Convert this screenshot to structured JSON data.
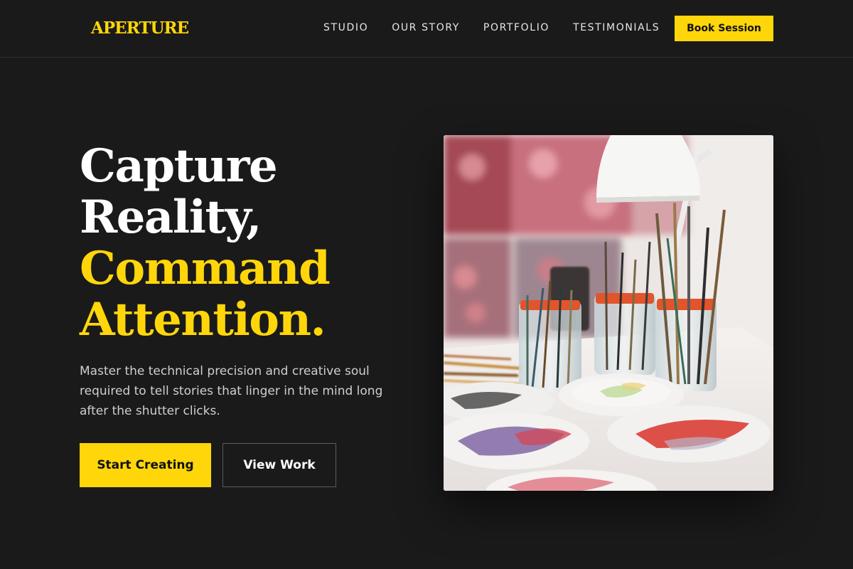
{
  "header": {
    "logo": "APERTURE",
    "nav": [
      "STUDIO",
      "OUR STORY",
      "PORTFOLIO",
      "TESTIMONIALS"
    ],
    "cta": "Book Session"
  },
  "hero": {
    "headline_line1": "Capture",
    "headline_line2": "Reality,",
    "headline_line3": "Command",
    "headline_line4": "Attention.",
    "description": "Master the technical precision and creative soul required to tell stories that linger in the mind long after the shutter clicks.",
    "primary_button": "Start Creating",
    "secondary_button": "View Work",
    "image_alt": "Artist studio table with jars of paint brushes, a desk lamp and paint palettes"
  },
  "colors": {
    "background": "#1a1a1a",
    "accent": "#ffd60a",
    "text": "#ffffff"
  }
}
